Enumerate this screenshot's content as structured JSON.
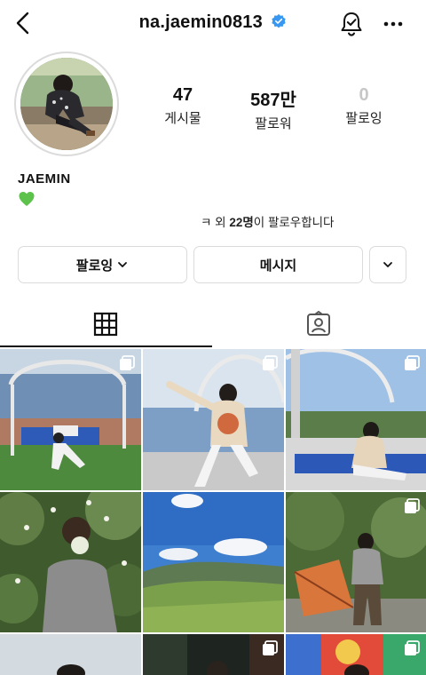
{
  "header": {
    "handle": "na.jaemin0813"
  },
  "stats": [
    {
      "value": "47",
      "label": "게시물"
    },
    {
      "value": "587만",
      "label": "팔로워"
    },
    {
      "value": "0",
      "label": "팔로잉"
    }
  ],
  "bio": {
    "name": "JAEMIN",
    "emoji": "💚"
  },
  "followed_by": {
    "prefix": "ㅋ 외 ",
    "count": "22명",
    "suffix": "이 팔로우합니다"
  },
  "buttons": {
    "follow": "팔로잉",
    "message": "메시지"
  },
  "colors": {
    "verified": "#3897f0",
    "border": "#dbdbdb",
    "heart": "#5cc24b"
  },
  "icons": [
    "back-icon",
    "verified-badge-icon",
    "notification-bell-icon",
    "more-options-icon",
    "chevron-down-icon",
    "grid-icon",
    "tagged-icon",
    "multi-photo-icon"
  ]
}
